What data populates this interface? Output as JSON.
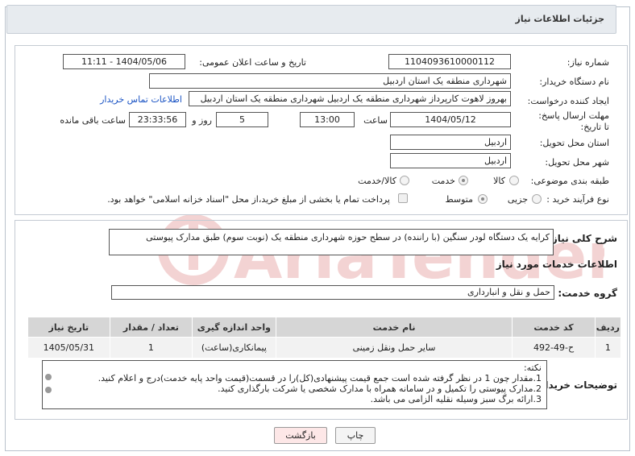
{
  "header": {
    "title": "جزئیات اطلاعات نیاز"
  },
  "info": {
    "need_number_label": "شماره نیاز:",
    "need_number": "1104093610000112",
    "announce_label": "تاریخ و ساعت اعلان عمومی:",
    "announce_value": "1404/05/06 - 11:11",
    "buyer_org_label": "نام دستگاه خریدار:",
    "buyer_org": "شهرداری منطقه یک استان اردبیل",
    "creator_label": "ایجاد کننده درخواست:",
    "creator": "بهروز لاهوت کارپرداز شهرداری منطقه یک اردبیل شهرداری منطقه یک استان اردبیل",
    "contact_link": "اطلاعات تماس خریدار",
    "deadline_label": "مهلت ارسال پاسخ: تا تاریخ:",
    "deadline_date": "1404/05/12",
    "time_label": "ساعت",
    "deadline_time": "13:00",
    "days_value": "5",
    "days_label": "روز و",
    "remaining_time": "23:33:56",
    "remaining_label": "ساعت باقی مانده",
    "province_label": "استان محل تحویل:",
    "province": "اردبیل",
    "city_label": "شهر محل تحویل:",
    "city": "اردبیل",
    "category_label": "طبقه بندی موضوعی:",
    "category_options": [
      "کالا",
      "خدمت",
      "کالا/خدمت"
    ],
    "category_selected": "خدمت",
    "process_label": "نوع فرآیند خرید :",
    "process_options": [
      "جزیی",
      "متوسط"
    ],
    "process_selected": "جزیی",
    "payment_note": "پرداخت تمام یا بخشی از مبلغ خرید،از محل \"اسناد خزانه اسلامی\" خواهد بود."
  },
  "details": {
    "summary_label": "شرح کلی نیاز:",
    "summary": "کرایه یک دستگاه لودر سنگین (با راننده) در سطح حوزه شهرداری منطقه یک (نوبت سوم) طبق مدارک پیوستی",
    "services_title": "اطلاعات خدمات مورد نیاز",
    "service_group_label": "گروه خدمت:",
    "service_group": "حمل و نقل و انبارداری",
    "table": {
      "headers": [
        "ردیف",
        "کد خدمت",
        "نام خدمت",
        "واحد اندازه گیری",
        "تعداد / مقدار",
        "تاریخ نیاز"
      ],
      "rows": [
        [
          "1",
          "ح-49-492",
          "سایر حمل ونقل زمینی",
          "پیمانکاری(ساعت)",
          "1",
          "1405/05/31"
        ]
      ]
    },
    "buyer_notes_label": "توضیحات خریدار:",
    "notes": [
      "نکته:",
      "1.مقدار چون 1 در نظر گرفته شده است جمع قیمت پیشنهادی(کل)را در قسمت(قیمت واحد پایه خدمت)درج و اعلام کنید.",
      "2.مدارک پیوستی را تکمیل و در سامانه همراه با مدارک شخصی یا شرکت بارگذاری کنید.",
      "3.ارائه برگ سبز وسیله نقلیه الزامی می باشد."
    ]
  },
  "buttons": {
    "print": "چاپ",
    "back": "بازگشت"
  },
  "colors": {
    "header_bg": "#e7ebef",
    "link": "#1b54c4",
    "back_button_bg": "#fde7e7",
    "watermark": "#f1c9c9"
  }
}
